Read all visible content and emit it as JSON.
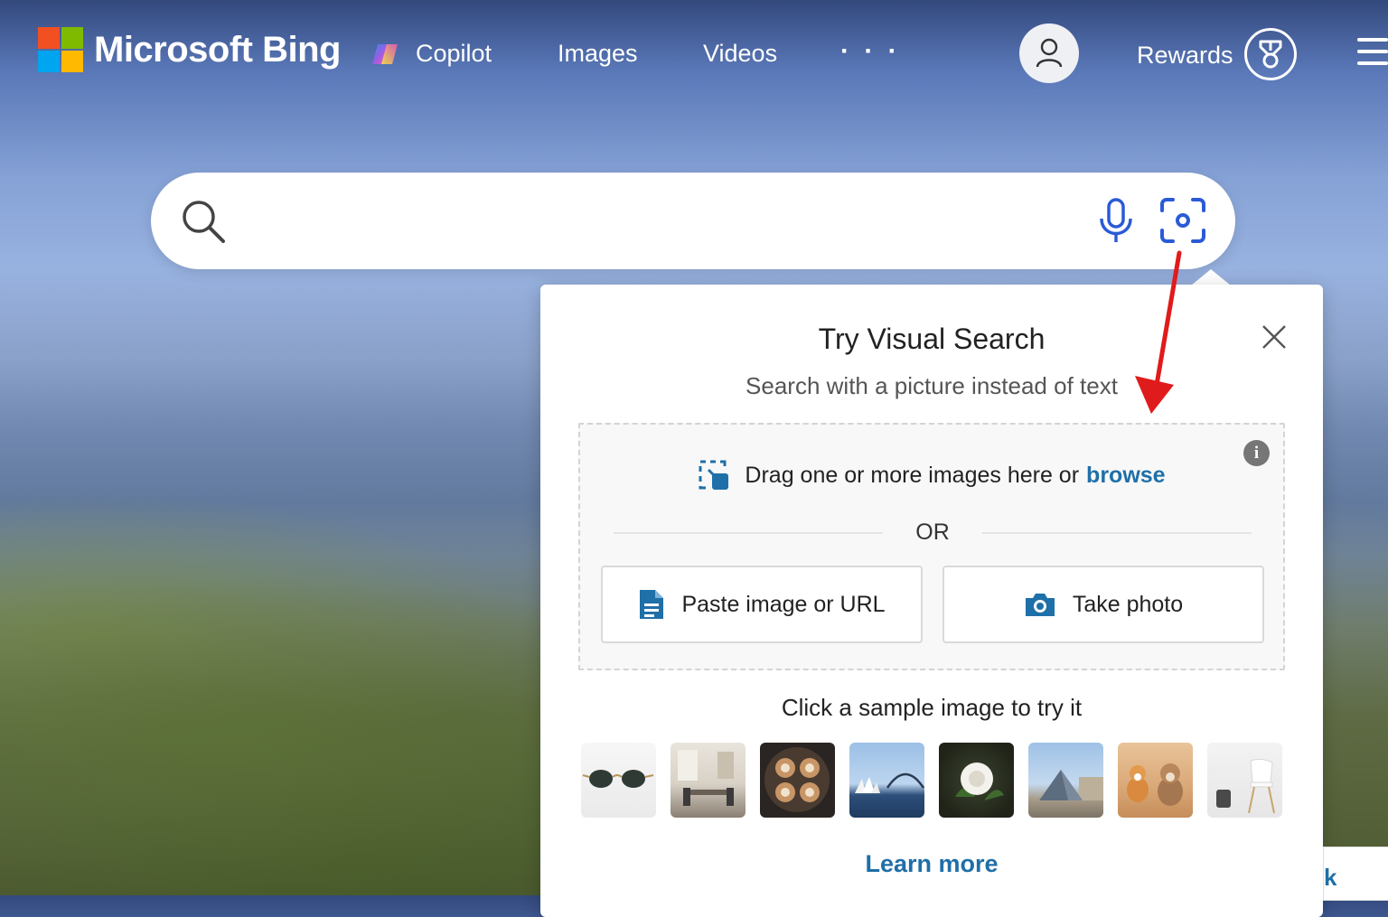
{
  "header": {
    "brand": "Microsoft Bing",
    "nav": [
      {
        "label": "Copilot",
        "icon": "copilot-icon"
      },
      {
        "label": "Images"
      },
      {
        "label": "Videos"
      },
      {
        "label": "· · ·"
      }
    ],
    "account_icon": "user-icon",
    "rewards_label": "Rewards",
    "rewards_icon": "trophy-icon",
    "menu_icon": "hamburger-menu-icon"
  },
  "search": {
    "placeholder": "",
    "value": "",
    "icons": [
      "search-icon",
      "microphone-icon",
      "visual-search-icon"
    ]
  },
  "visual_search_popup": {
    "title": "Try Visual Search",
    "subtitle": "Search with a picture instead of text",
    "drag_text": "Drag one or more images here or",
    "browse_link": "browse",
    "or_label": "OR",
    "paste_button": "Paste image or URL",
    "photo_button": "Take photo",
    "sample_label": "Click a sample image to try it",
    "samples": [
      "sunglasses",
      "dining-room",
      "latte-art",
      "sydney-opera-house",
      "white-rose",
      "louvre-pyramid",
      "dogs",
      "white-chair"
    ],
    "learn_more": "Learn more"
  },
  "side_tab_label": "k",
  "colors": {
    "accent_link": "#1f6fa8",
    "visual_search_blue": "#2a5bd7",
    "annotation_arrow": "#e01b1b"
  }
}
